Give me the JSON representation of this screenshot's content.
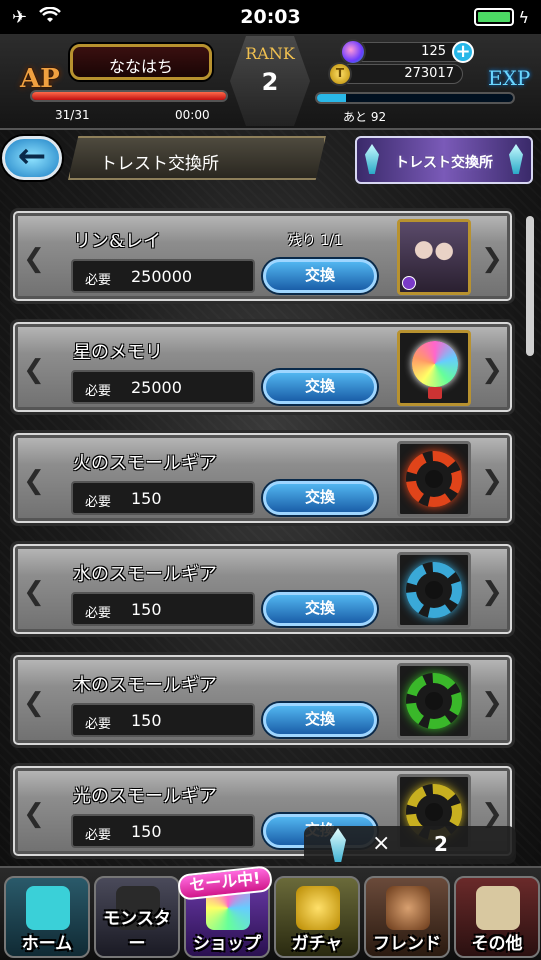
{
  "status": {
    "time": "20:03",
    "airplane_icon": "airplane-icon",
    "wifi_icon": "wifi-icon",
    "battery_icon": "battery-icon",
    "charging_icon": "bolt-icon"
  },
  "player": {
    "name": "ななはち",
    "ap_label": "AP",
    "ap_value": "31/31",
    "ap_fill": 1.0,
    "ap_timer": "00:00",
    "rank_label": "RANK",
    "rank": "2",
    "gems": "125",
    "coins": "273017",
    "coin_symbol": "T",
    "exp_label": "EXP",
    "exp_remaining": "あと 92",
    "exp_fill": 0.15
  },
  "titlebar": {
    "back_icon": "←",
    "title": "トレスト交換所",
    "banner_label": "トレスト交換所"
  },
  "items": [
    {
      "name": "リン&レイ",
      "remaining": "残り 1/1",
      "req_label": "必要",
      "req_value": "250000",
      "button": "交換",
      "thumb": "character-portrait"
    },
    {
      "name": "星のメモリ",
      "remaining": "",
      "req_label": "必要",
      "req_value": "25000",
      "button": "交換",
      "thumb": "memory-orb"
    },
    {
      "name": "火のスモールギア",
      "remaining": "",
      "req_label": "必要",
      "req_value": "150",
      "button": "交換",
      "thumb": "gear-icon",
      "color": "#e0441a"
    },
    {
      "name": "水のスモールギア",
      "remaining": "",
      "req_label": "必要",
      "req_value": "150",
      "button": "交換",
      "thumb": "gear-icon",
      "color": "#3aa9d8"
    },
    {
      "name": "木のスモールギア",
      "remaining": "",
      "req_label": "必要",
      "req_value": "150",
      "button": "交換",
      "thumb": "gear-icon",
      "color": "#3ab82a"
    },
    {
      "name": "光のスモールギア",
      "remaining": "",
      "req_label": "必要",
      "req_value": "150",
      "button": "交換",
      "thumb": "gear-icon",
      "color": "#c8b020"
    }
  ],
  "count": {
    "icon": "crystal-icon",
    "times": "×",
    "value": "2"
  },
  "nav": {
    "sale_tag": "セール中!",
    "items": [
      "ホーム",
      "モンスター",
      "ショップ",
      "ガチャ",
      "フレンド",
      "その他"
    ]
  },
  "colors": {
    "accent_blue": "#2ab8e8",
    "ap_red": "#c01010",
    "gold": "#b8922f"
  }
}
